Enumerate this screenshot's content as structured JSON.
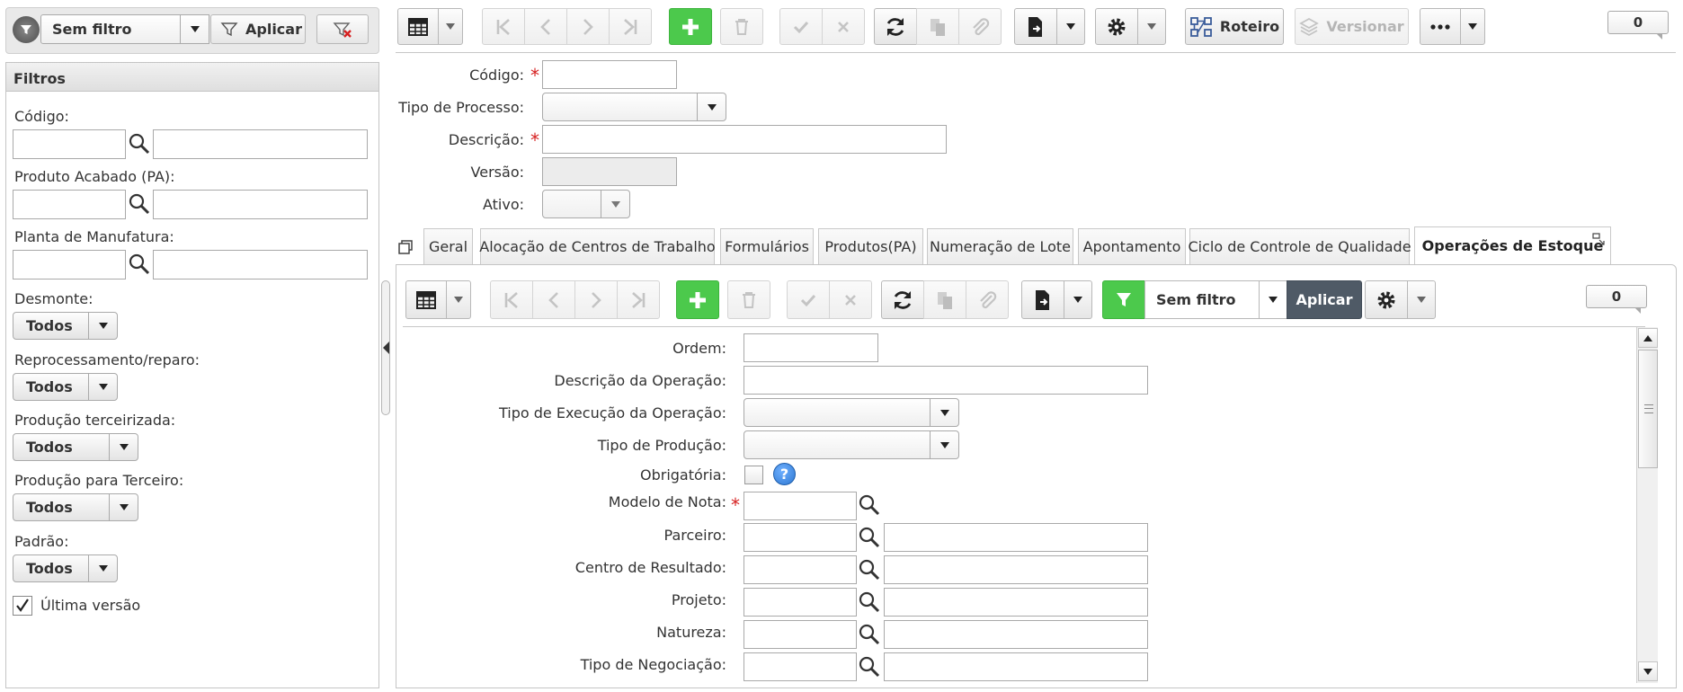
{
  "left_toolbar": {
    "filter_select_value": "Sem filtro",
    "apply_label": "Aplicar"
  },
  "filters_panel": {
    "title": "Filtros",
    "codigo_label": "Código:",
    "produto_label": "Produto Acabado (PA):",
    "planta_label": "Planta de Manufatura:",
    "desmonte_label": "Desmonte:",
    "desmonte_value": "Todos",
    "reprocessamento_label": "Reprocessamento/reparo:",
    "reprocessamento_value": "Todos",
    "terceirizada_label": "Produção terceirizada:",
    "terceirizada_value": "Todos",
    "para_terceiro_label": "Produção para Terceiro:",
    "para_terceiro_value": "Todos",
    "padrao_label": "Padrão:",
    "padrao_value": "Todos",
    "ultima_versao_label": "Última versão",
    "ultima_versao_checked": true
  },
  "main_toolbar": {
    "roteiro_label": "Roteiro",
    "versionar_label": "Versionar",
    "counter": "0"
  },
  "header_form": {
    "codigo_label": "Código:",
    "tipo_processo_label": "Tipo de Processo:",
    "descricao_label": "Descrição:",
    "versao_label": "Versão:",
    "ativo_label": "Ativo:"
  },
  "tabs": [
    {
      "label": "Geral"
    },
    {
      "label": "Alocação de Centros de Trabalho"
    },
    {
      "label": "Formulários"
    },
    {
      "label": "Produtos(PA)"
    },
    {
      "label": "Numeração de Lote"
    },
    {
      "label": "Apontamento"
    },
    {
      "label": "Ciclo de Controle de Qualidade"
    },
    {
      "label": "Operações de Estoque"
    }
  ],
  "sub_toolbar": {
    "filter_value": "Sem filtro",
    "apply_label": "Aplicar",
    "counter": "0"
  },
  "detail_form": {
    "ordem_label": "Ordem:",
    "descricao_operacao_label": "Descrição da Operação:",
    "tipo_execucao_label": "Tipo de Execução da Operação:",
    "tipo_producao_label": "Tipo de Produção:",
    "obrigatoria_label": "Obrigatória:",
    "modelo_nota_label": "Modelo de Nota:",
    "parceiro_label": "Parceiro:",
    "centro_resultado_label": "Centro de Resultado:",
    "projeto_label": "Projeto:",
    "natureza_label": "Natureza:",
    "tipo_negociacao_label": "Tipo de Negociação:"
  },
  "colors": {
    "accent_green": "#4cc94c",
    "apply_dark": "#4f5a66",
    "required_red": "#d62020",
    "help_blue": "#2e78d2"
  }
}
